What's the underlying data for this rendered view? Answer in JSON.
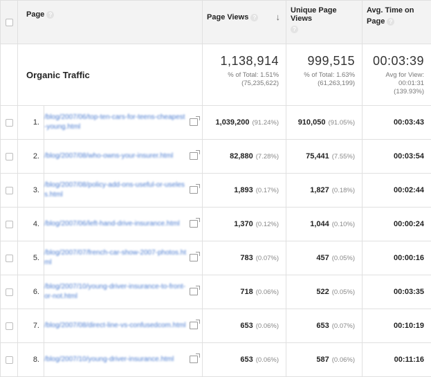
{
  "header": {
    "page": "Page",
    "page_views": "Page Views",
    "unique_page_views": "Unique Page Views",
    "avg_time_line1": "Avg. Time on",
    "avg_time_line2": "Page",
    "help_glyph": "?",
    "sort_glyph": "↓"
  },
  "summary": {
    "label": "Organic Traffic",
    "page_views": "1,138,914",
    "page_views_sub1": "% of Total: 1.51%",
    "page_views_sub2": "(75,235,622)",
    "unique_page_views": "999,515",
    "unique_sub1": "% of Total: 1.63%",
    "unique_sub2": "(61,263,199)",
    "avg_time": "00:03:39",
    "avg_sub1": "Avg for View:",
    "avg_sub2": "00:01:31",
    "avg_sub3": "(139.93%)"
  },
  "rows": [
    {
      "num": "1.",
      "url": "/blog/2007/06/top-ten-cars-for-teens-cheapest-young.html",
      "pv": "1,039,200",
      "pv_pct": "(91.24%)",
      "upv": "910,050",
      "upv_pct": "(91.05%)",
      "time": "00:03:43"
    },
    {
      "num": "2.",
      "url": "/blog/2007/08/who-owns-your-insurer.html",
      "pv": "82,880",
      "pv_pct": "(7.28%)",
      "upv": "75,441",
      "upv_pct": "(7.55%)",
      "time": "00:03:54"
    },
    {
      "num": "3.",
      "url": "/blog/2007/08/policy-add-ons-useful-or-useless.html",
      "pv": "1,893",
      "pv_pct": "(0.17%)",
      "upv": "1,827",
      "upv_pct": "(0.18%)",
      "time": "00:02:44"
    },
    {
      "num": "4.",
      "url": "/blog/2007/06/left-hand-drive-insurance.html",
      "pv": "1,370",
      "pv_pct": "(0.12%)",
      "upv": "1,044",
      "upv_pct": "(0.10%)",
      "time": "00:00:24"
    },
    {
      "num": "5.",
      "url": "/blog/2007/07/french-car-show-2007-photos.html",
      "pv": "783",
      "pv_pct": "(0.07%)",
      "upv": "457",
      "upv_pct": "(0.05%)",
      "time": "00:00:16"
    },
    {
      "num": "6.",
      "url": "/blog/2007/10/young-driver-insurance-to-front-or-not.html",
      "pv": "718",
      "pv_pct": "(0.06%)",
      "upv": "522",
      "upv_pct": "(0.05%)",
      "time": "00:03:35"
    },
    {
      "num": "7.",
      "url": "/blog/2007/08/direct-line-vs-confusedcom.html",
      "pv": "653",
      "pv_pct": "(0.06%)",
      "upv": "653",
      "upv_pct": "(0.07%)",
      "time": "00:10:19"
    },
    {
      "num": "8.",
      "url": "/blog/2007/10/young-driver-insurance.html",
      "pv": "653",
      "pv_pct": "(0.06%)",
      "upv": "587",
      "upv_pct": "(0.06%)",
      "time": "00:11:16"
    }
  ]
}
